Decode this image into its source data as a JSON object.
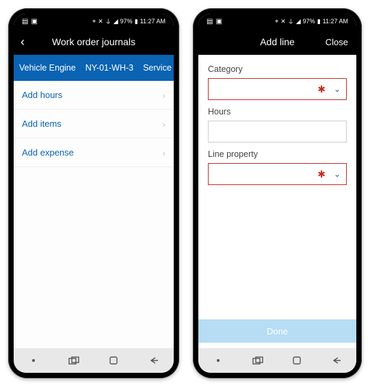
{
  "status": {
    "battery": "97%",
    "time": "11:27 AM"
  },
  "phone1": {
    "title": "Work order journals",
    "subheader": {
      "c1": "Vehicle Engine",
      "c2": "NY-01-WH-3",
      "c3": "Service"
    },
    "items": [
      "Add hours",
      "Add items",
      "Add expense"
    ]
  },
  "phone2": {
    "title": "Add line",
    "close": "Close",
    "labels": {
      "category": "Category",
      "hours": "Hours",
      "lineprop": "Line property"
    },
    "done": "Done"
  }
}
